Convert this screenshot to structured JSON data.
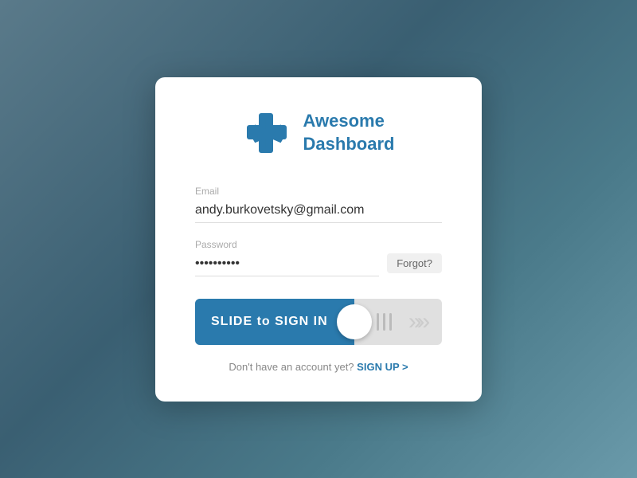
{
  "app": {
    "title_line1": "Awesome",
    "title_line2": "Dashboard"
  },
  "form": {
    "email_label": "Email",
    "email_value": "andy.burkovetsky@gmail.com",
    "password_label": "Password",
    "password_value": "••••••••••",
    "forgot_label": "Forgot?"
  },
  "slide": {
    "label": "SLIDE to SIGN IN",
    "arrows": ">>"
  },
  "signup": {
    "text": "Don't have an account yet?",
    "link": "SIGN UP >"
  }
}
